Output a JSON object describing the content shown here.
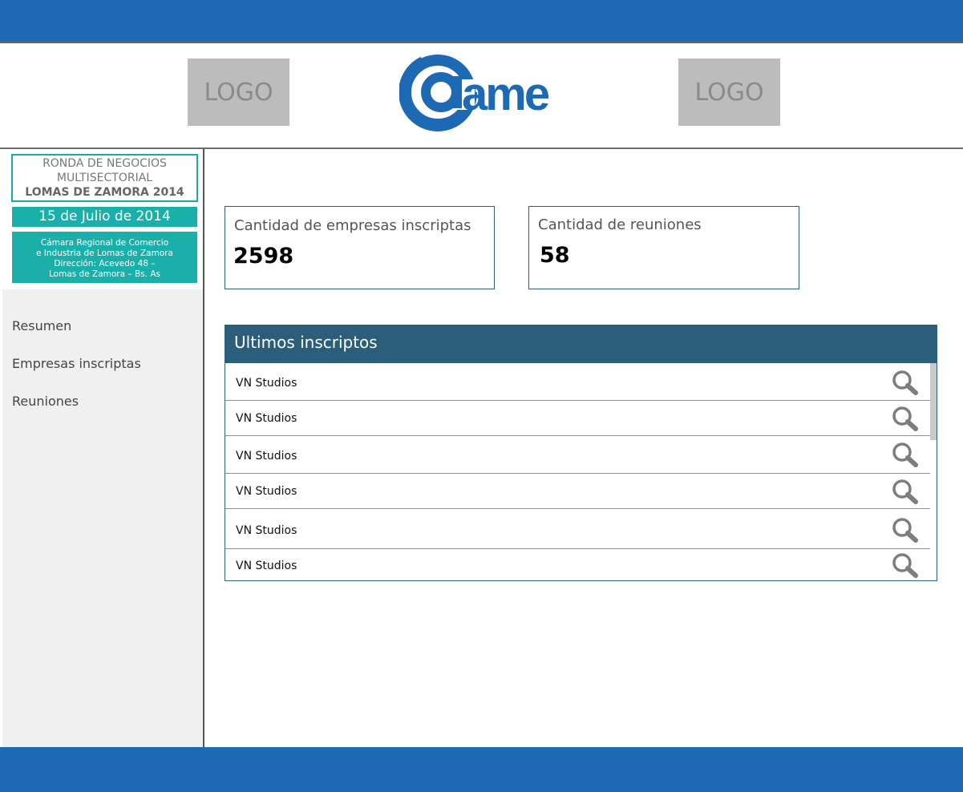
{
  "header": {
    "logo_left": "LOGO",
    "logo_right": "LOGO",
    "brand_text": "ame",
    "brand_color": "#1d69b4"
  },
  "event": {
    "line1": "RONDA DE NEGOCIOS",
    "line2": "MULTISECTORIAL",
    "line3": "LOMAS DE ZAMORA 2014",
    "date": "15 de Julio de 2014",
    "address": [
      "Cámara Regional de Comercio",
      "e Industria de Lomas de Zamora",
      "Dirección: Acevedo 48 –",
      "Lomas de Zamora – Bs. As"
    ]
  },
  "nav": {
    "items": [
      {
        "label": "Resumen"
      },
      {
        "label": "Empresas inscriptas"
      },
      {
        "label": "Reuniones"
      }
    ]
  },
  "stats": [
    {
      "label": "Cantidad de empresas inscriptas",
      "value": "2598"
    },
    {
      "label": "Cantidad de reuniones",
      "value": "58"
    }
  ],
  "latest": {
    "title": "Ultimos inscriptos",
    "rows": [
      {
        "name": "VN Studios",
        "icon": "search-icon"
      },
      {
        "name": "VN Studios",
        "icon": "search-icon"
      },
      {
        "name": "VN Studios",
        "icon": "search-icon"
      },
      {
        "name": "VN Studios",
        "icon": "search-icon"
      },
      {
        "name": "VN Studios",
        "icon": "search-icon"
      },
      {
        "name": "VN Studios",
        "icon": "search-icon"
      }
    ]
  },
  "colors": {
    "primary_blue": "#1d69b4",
    "teal": "#1aafa8",
    "panel_header": "#2b5e7b",
    "sidebar_bg": "#f0f0f0"
  }
}
